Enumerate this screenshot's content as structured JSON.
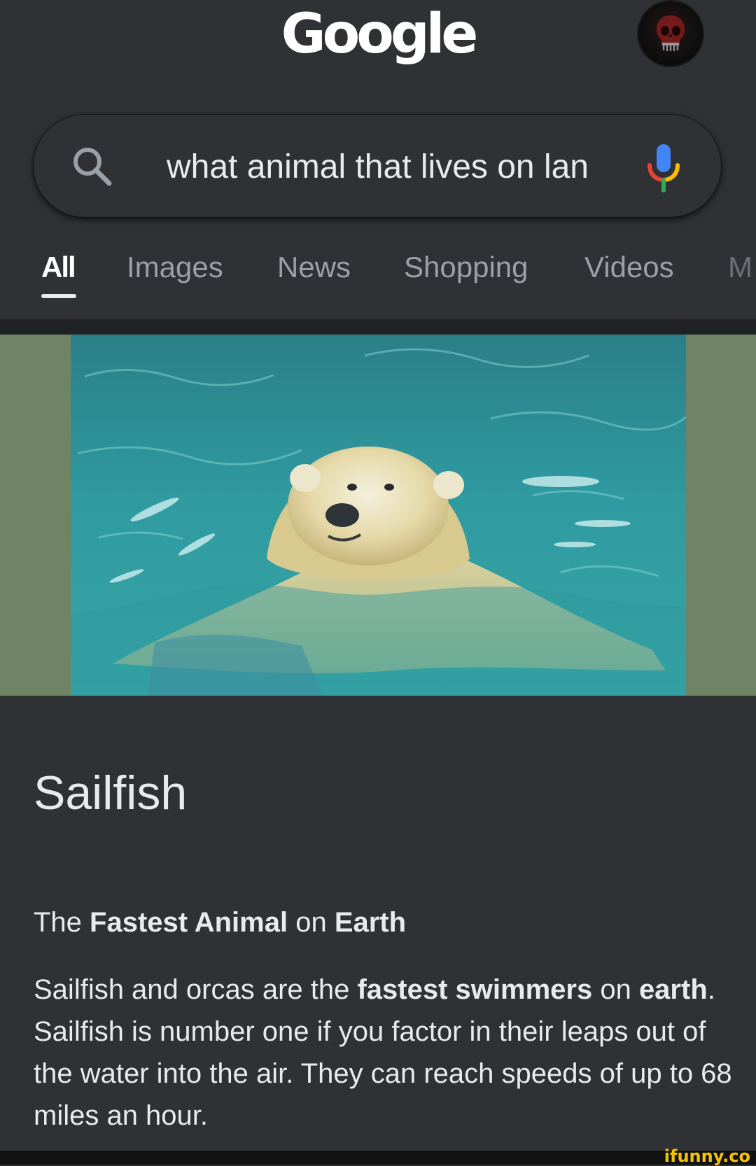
{
  "header": {
    "logo": "Google"
  },
  "search": {
    "query": "what animal that lives on lan"
  },
  "tabs": [
    {
      "label": "All",
      "active": true
    },
    {
      "label": "Images",
      "active": false
    },
    {
      "label": "News",
      "active": false
    },
    {
      "label": "Shopping",
      "active": false
    },
    {
      "label": "Videos",
      "active": false
    },
    {
      "label": "M",
      "active": false
    }
  ],
  "result": {
    "title": "Sailfish",
    "subtitle": {
      "part1": "The ",
      "bold1": "Fastest Animal",
      "part2": " on ",
      "bold2": "Earth"
    },
    "body": {
      "part1": "Sailfish and orcas are the ",
      "bold1": "fastest swimmers",
      "part2": " on ",
      "bold2": "earth",
      "part3": ". Sailfish is number one if you factor in their leaps out of the water into the air. They can reach speeds of up to 68 miles an hour."
    }
  },
  "icons": {
    "search": "search-icon",
    "mic": "mic-icon",
    "avatar": "skull-avatar"
  },
  "colors": {
    "background": "#303134",
    "water": "#2f9aa0",
    "image_margin": "#6f8465",
    "mic_blue": "#4285f4",
    "mic_red": "#ea4335",
    "mic_yellow": "#fbbc05",
    "mic_green": "#34a853"
  },
  "watermark": "ifunny.co"
}
